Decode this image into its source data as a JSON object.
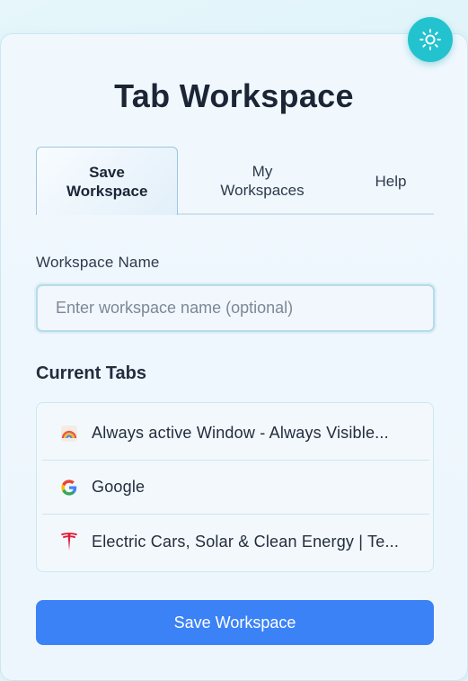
{
  "header": {
    "title": "Tab Workspace",
    "theme_toggle_icon": "sun-icon"
  },
  "tabs": [
    {
      "label": "Save Workspace",
      "active": true
    },
    {
      "label": "My Workspaces",
      "active": false
    },
    {
      "label": "Help",
      "active": false
    }
  ],
  "form": {
    "name_label": "Workspace Name",
    "name_placeholder": "Enter workspace name (optional)",
    "name_value": ""
  },
  "current_tabs": {
    "title": "Current Tabs",
    "items": [
      {
        "title": "Always active Window - Always Visible...",
        "favicon": "rainbow-favicon-icon"
      },
      {
        "title": "Google",
        "favicon": "google-favicon-icon"
      },
      {
        "title": "Electric Cars, Solar & Clean Energy | Te...",
        "favicon": "tesla-favicon-icon"
      }
    ]
  },
  "actions": {
    "save_label": "Save Workspace"
  },
  "colors": {
    "accent": "#3b82f6",
    "theme_button": "#22c3cf",
    "text": "#1b2536"
  }
}
